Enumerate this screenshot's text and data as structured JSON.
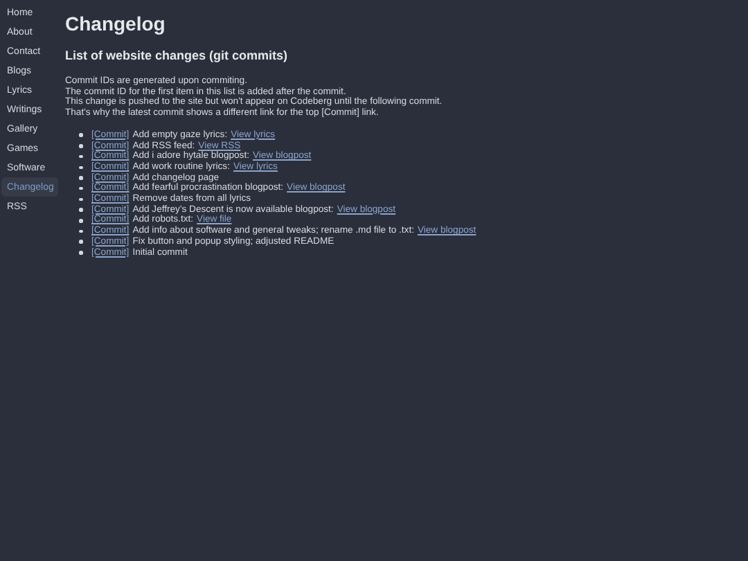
{
  "sidebar": {
    "items": [
      {
        "label": "Home",
        "selected": false
      },
      {
        "label": "About",
        "selected": false
      },
      {
        "label": "Contact",
        "selected": false
      },
      {
        "label": "Blogs",
        "selected": false
      },
      {
        "label": "Lyrics",
        "selected": false
      },
      {
        "label": "Writings",
        "selected": false
      },
      {
        "label": "Gallery",
        "selected": false
      },
      {
        "label": "Games",
        "selected": false
      },
      {
        "label": "Software",
        "selected": false
      },
      {
        "label": "Changelog",
        "selected": true
      },
      {
        "label": "RSS",
        "selected": false
      }
    ]
  },
  "title": "Changelog",
  "subtitle": "List of website changes (git commits)",
  "intro": [
    "Commit IDs are generated upon commiting.",
    "The commit ID for the first item in this list is added after the commit.",
    "This change is pushed to the site but won't appear on Codeberg until the following commit.",
    "That's why the latest commit shows a different link for the top [Commit] link."
  ],
  "commits": [
    {
      "commit": "[Commit]",
      "message": "Add empty gaze lyrics:",
      "link": "View lyrics"
    },
    {
      "commit": "[Commit]",
      "message": "Add RSS feed:",
      "link": "View RSS"
    },
    {
      "commit": "[Commit]",
      "message": "Add i adore hytale blogpost:",
      "link": "View blogpost"
    },
    {
      "commit": "[Commit]",
      "message": "Add work routine lyrics:",
      "link": "View lyrics"
    },
    {
      "commit": "[Commit]",
      "message": "Add changelog page"
    },
    {
      "commit": "[Commit]",
      "message": "Add fearful procrastination blogpost:",
      "link": "View blogpost"
    },
    {
      "commit": "[Commit]",
      "message": "Remove dates from all lyrics"
    },
    {
      "commit": "[Commit]",
      "message": "Add Jeffrey's Descent is now available blogpost:",
      "link": "View blogpost"
    },
    {
      "commit": "[Commit]",
      "message": "Add robots.txt:",
      "link": "View file"
    },
    {
      "commit": "[Commit]",
      "message": "Add info about software and general tweaks; rename .md file to .txt:",
      "link": "View blogpost"
    },
    {
      "commit": "[Commit]",
      "message": "Fix button and popup styling; adjusted README"
    },
    {
      "commit": "[Commit]",
      "message": "Initial commit"
    }
  ]
}
